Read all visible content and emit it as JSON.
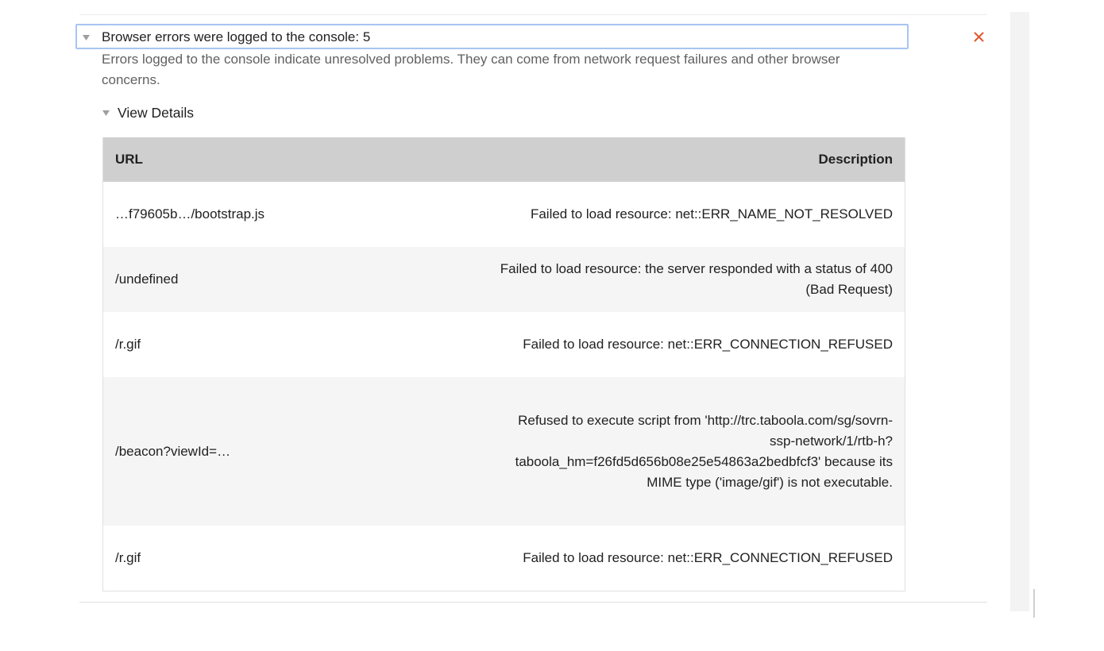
{
  "audit": {
    "title": "Browser errors were logged to the console: 5",
    "description": "Errors logged to the console indicate unresolved problems. They can come from network request failures and other browser concerns.",
    "close_icon": "close-icon",
    "close_color": "#e0592c"
  },
  "details": {
    "toggle_label": "View Details",
    "table": {
      "headers": {
        "url": "URL",
        "description": "Description"
      },
      "rows": [
        {
          "url": "…f79605b…/bootstrap.js",
          "description": "Failed to load resource: net::ERR_NAME_NOT_RESOLVED"
        },
        {
          "url": "/undefined",
          "description": "Failed to load resource: the server responded with a status of 400 (Bad Request)"
        },
        {
          "url": "/r.gif",
          "description": "Failed to load resource: net::ERR_CONNECTION_REFUSED"
        },
        {
          "url": "/beacon?viewId=…",
          "description": "Refused to execute script from 'http://trc.taboola.com/sg/sovrn-ssp-network/1/rtb-h?taboola_hm=f26fd5d656b08e25e54863a2bedbfcf3' because its MIME type ('image/gif') is not executable."
        },
        {
          "url": "/r.gif",
          "description": "Failed to load resource: net::ERR_CONNECTION_REFUSED"
        }
      ]
    }
  },
  "colors": {
    "header_bg": "#cfcfcf",
    "row_stripe": "#f5f5f5",
    "focus_outline": "#a7c5f2",
    "secondary_text": "#616161"
  }
}
